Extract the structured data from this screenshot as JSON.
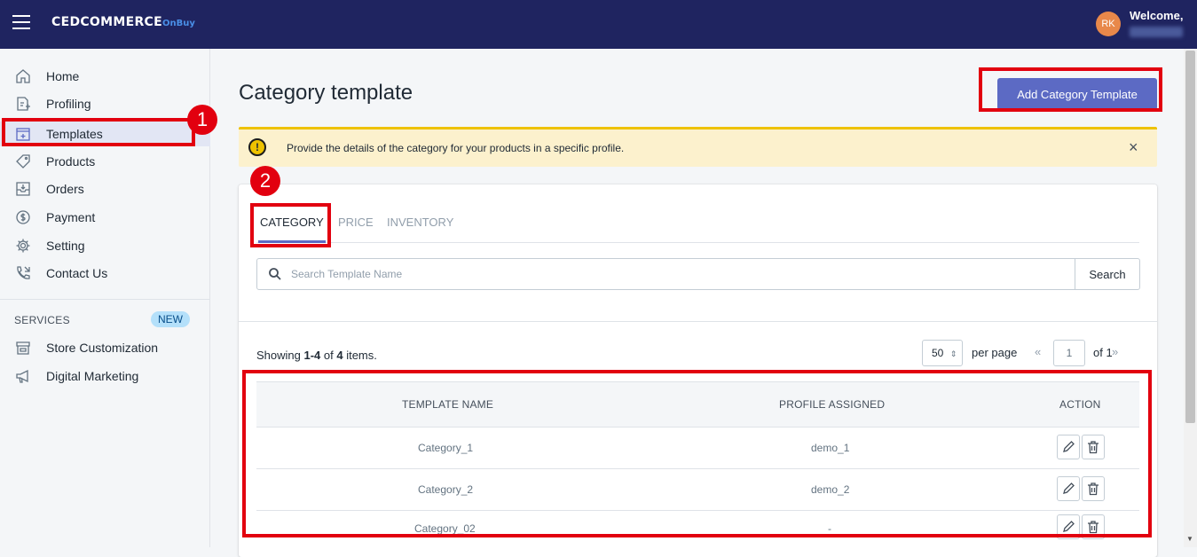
{
  "header": {
    "brand": "CEDCOMMERCE",
    "brand_sub": "OnBuy",
    "avatar_initials": "RK",
    "welcome": "Welcome,"
  },
  "sidebar": {
    "items": [
      {
        "label": "Home",
        "icon": "home-icon"
      },
      {
        "label": "Profiling",
        "icon": "profiling-icon"
      },
      {
        "label": "Templates",
        "icon": "templates-icon",
        "active": true
      },
      {
        "label": "Products",
        "icon": "tag-icon"
      },
      {
        "label": "Orders",
        "icon": "orders-icon"
      },
      {
        "label": "Payment",
        "icon": "dollar-icon"
      },
      {
        "label": "Setting",
        "icon": "gear-icon"
      },
      {
        "label": "Contact Us",
        "icon": "phone-icon"
      }
    ],
    "services_title": "SERVICES",
    "services_badge": "NEW",
    "services": [
      {
        "label": "Store Customization",
        "icon": "store-icon"
      },
      {
        "label": "Digital Marketing",
        "icon": "megaphone-icon"
      }
    ]
  },
  "main": {
    "title": "Category template",
    "add_button": "Add Category Template",
    "banner_text": "Provide the details of the category for your products in a specific profile.",
    "banner_icon": "!",
    "close_glyph": "×",
    "tabs": [
      "CATEGORY",
      "PRICE",
      "INVENTORY"
    ],
    "search_placeholder": "Search Template Name",
    "search_button": "Search",
    "showing_prefix": "Showing ",
    "showing_range": "1-4",
    "showing_mid": " of ",
    "showing_total": "4",
    "showing_suffix": " items.",
    "per_page_value": "50",
    "per_page_label": "per page",
    "page_prev": "«",
    "page_current": "1",
    "page_of": "of 1",
    "page_next": "»",
    "columns": [
      "TEMPLATE NAME",
      "PROFILE ASSIGNED",
      "ACTION"
    ],
    "rows": [
      {
        "template": "Category_1",
        "profile": "demo_1"
      },
      {
        "template": "Category_2",
        "profile": "demo_2"
      },
      {
        "template": "Category_02",
        "profile": "-"
      }
    ]
  },
  "annotations": {
    "marker_1": "1",
    "marker_2": "2",
    "color": "#e2000f"
  },
  "colors": {
    "topbar": "#1f2460",
    "accent": "#5c6ac4",
    "banner_bg": "#fcf1cd",
    "banner_border": "#eec200"
  }
}
